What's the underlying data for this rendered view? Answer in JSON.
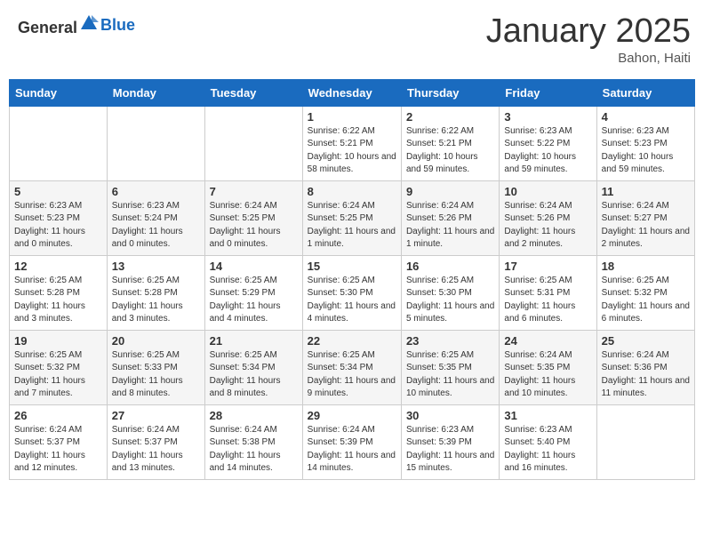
{
  "header": {
    "logo_general": "General",
    "logo_blue": "Blue",
    "month_title": "January 2025",
    "location": "Bahon, Haiti"
  },
  "weekdays": [
    "Sunday",
    "Monday",
    "Tuesday",
    "Wednesday",
    "Thursday",
    "Friday",
    "Saturday"
  ],
  "weeks": [
    [
      {
        "day": "",
        "info": ""
      },
      {
        "day": "",
        "info": ""
      },
      {
        "day": "",
        "info": ""
      },
      {
        "day": "1",
        "info": "Sunrise: 6:22 AM\nSunset: 5:21 PM\nDaylight: 10 hours and 58 minutes."
      },
      {
        "day": "2",
        "info": "Sunrise: 6:22 AM\nSunset: 5:21 PM\nDaylight: 10 hours and 59 minutes."
      },
      {
        "day": "3",
        "info": "Sunrise: 6:23 AM\nSunset: 5:22 PM\nDaylight: 10 hours and 59 minutes."
      },
      {
        "day": "4",
        "info": "Sunrise: 6:23 AM\nSunset: 5:23 PM\nDaylight: 10 hours and 59 minutes."
      }
    ],
    [
      {
        "day": "5",
        "info": "Sunrise: 6:23 AM\nSunset: 5:23 PM\nDaylight: 11 hours and 0 minutes."
      },
      {
        "day": "6",
        "info": "Sunrise: 6:23 AM\nSunset: 5:24 PM\nDaylight: 11 hours and 0 minutes."
      },
      {
        "day": "7",
        "info": "Sunrise: 6:24 AM\nSunset: 5:25 PM\nDaylight: 11 hours and 0 minutes."
      },
      {
        "day": "8",
        "info": "Sunrise: 6:24 AM\nSunset: 5:25 PM\nDaylight: 11 hours and 1 minute."
      },
      {
        "day": "9",
        "info": "Sunrise: 6:24 AM\nSunset: 5:26 PM\nDaylight: 11 hours and 1 minute."
      },
      {
        "day": "10",
        "info": "Sunrise: 6:24 AM\nSunset: 5:26 PM\nDaylight: 11 hours and 2 minutes."
      },
      {
        "day": "11",
        "info": "Sunrise: 6:24 AM\nSunset: 5:27 PM\nDaylight: 11 hours and 2 minutes."
      }
    ],
    [
      {
        "day": "12",
        "info": "Sunrise: 6:25 AM\nSunset: 5:28 PM\nDaylight: 11 hours and 3 minutes."
      },
      {
        "day": "13",
        "info": "Sunrise: 6:25 AM\nSunset: 5:28 PM\nDaylight: 11 hours and 3 minutes."
      },
      {
        "day": "14",
        "info": "Sunrise: 6:25 AM\nSunset: 5:29 PM\nDaylight: 11 hours and 4 minutes."
      },
      {
        "day": "15",
        "info": "Sunrise: 6:25 AM\nSunset: 5:30 PM\nDaylight: 11 hours and 4 minutes."
      },
      {
        "day": "16",
        "info": "Sunrise: 6:25 AM\nSunset: 5:30 PM\nDaylight: 11 hours and 5 minutes."
      },
      {
        "day": "17",
        "info": "Sunrise: 6:25 AM\nSunset: 5:31 PM\nDaylight: 11 hours and 6 minutes."
      },
      {
        "day": "18",
        "info": "Sunrise: 6:25 AM\nSunset: 5:32 PM\nDaylight: 11 hours and 6 minutes."
      }
    ],
    [
      {
        "day": "19",
        "info": "Sunrise: 6:25 AM\nSunset: 5:32 PM\nDaylight: 11 hours and 7 minutes."
      },
      {
        "day": "20",
        "info": "Sunrise: 6:25 AM\nSunset: 5:33 PM\nDaylight: 11 hours and 8 minutes."
      },
      {
        "day": "21",
        "info": "Sunrise: 6:25 AM\nSunset: 5:34 PM\nDaylight: 11 hours and 8 minutes."
      },
      {
        "day": "22",
        "info": "Sunrise: 6:25 AM\nSunset: 5:34 PM\nDaylight: 11 hours and 9 minutes."
      },
      {
        "day": "23",
        "info": "Sunrise: 6:25 AM\nSunset: 5:35 PM\nDaylight: 11 hours and 10 minutes."
      },
      {
        "day": "24",
        "info": "Sunrise: 6:24 AM\nSunset: 5:35 PM\nDaylight: 11 hours and 10 minutes."
      },
      {
        "day": "25",
        "info": "Sunrise: 6:24 AM\nSunset: 5:36 PM\nDaylight: 11 hours and 11 minutes."
      }
    ],
    [
      {
        "day": "26",
        "info": "Sunrise: 6:24 AM\nSunset: 5:37 PM\nDaylight: 11 hours and 12 minutes."
      },
      {
        "day": "27",
        "info": "Sunrise: 6:24 AM\nSunset: 5:37 PM\nDaylight: 11 hours and 13 minutes."
      },
      {
        "day": "28",
        "info": "Sunrise: 6:24 AM\nSunset: 5:38 PM\nDaylight: 11 hours and 14 minutes."
      },
      {
        "day": "29",
        "info": "Sunrise: 6:24 AM\nSunset: 5:39 PM\nDaylight: 11 hours and 14 minutes."
      },
      {
        "day": "30",
        "info": "Sunrise: 6:23 AM\nSunset: 5:39 PM\nDaylight: 11 hours and 15 minutes."
      },
      {
        "day": "31",
        "info": "Sunrise: 6:23 AM\nSunset: 5:40 PM\nDaylight: 11 hours and 16 minutes."
      },
      {
        "day": "",
        "info": ""
      }
    ]
  ]
}
